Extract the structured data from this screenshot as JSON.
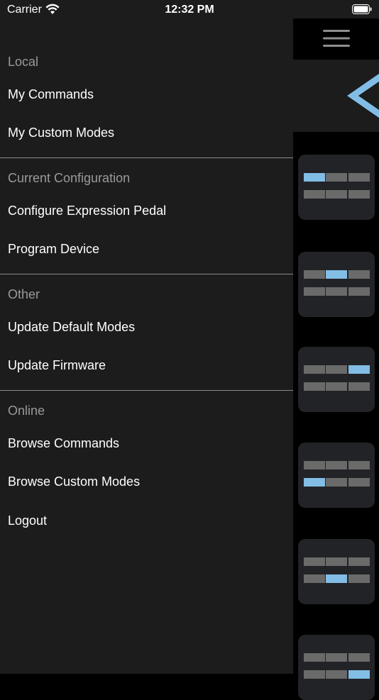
{
  "status_bar": {
    "carrier": "Carrier",
    "time": "12:32 PM"
  },
  "drawer": {
    "sections": [
      {
        "header": "Local",
        "items": [
          "My Commands",
          "My Custom Modes"
        ]
      },
      {
        "header": "Current Configuration",
        "items": [
          "Configure Expression Pedal",
          "Program Device"
        ]
      },
      {
        "header": "Other",
        "items": [
          "Update Default Modes",
          "Update Firmware"
        ]
      },
      {
        "header": "Online",
        "items": [
          "Browse Commands",
          "Browse Custom Modes",
          "Logout"
        ]
      }
    ]
  },
  "icons": {
    "menu": "hamburger-icon",
    "back": "back-chevron-icon"
  },
  "colors": {
    "drawer_bg": "#1c1c1c",
    "accent": "#82bde6",
    "section_header": "#9a9a9a",
    "cell_off": "#6a6a6a"
  },
  "mode_grid": {
    "active_cells": [
      0,
      1,
      2,
      3,
      4,
      5
    ]
  }
}
